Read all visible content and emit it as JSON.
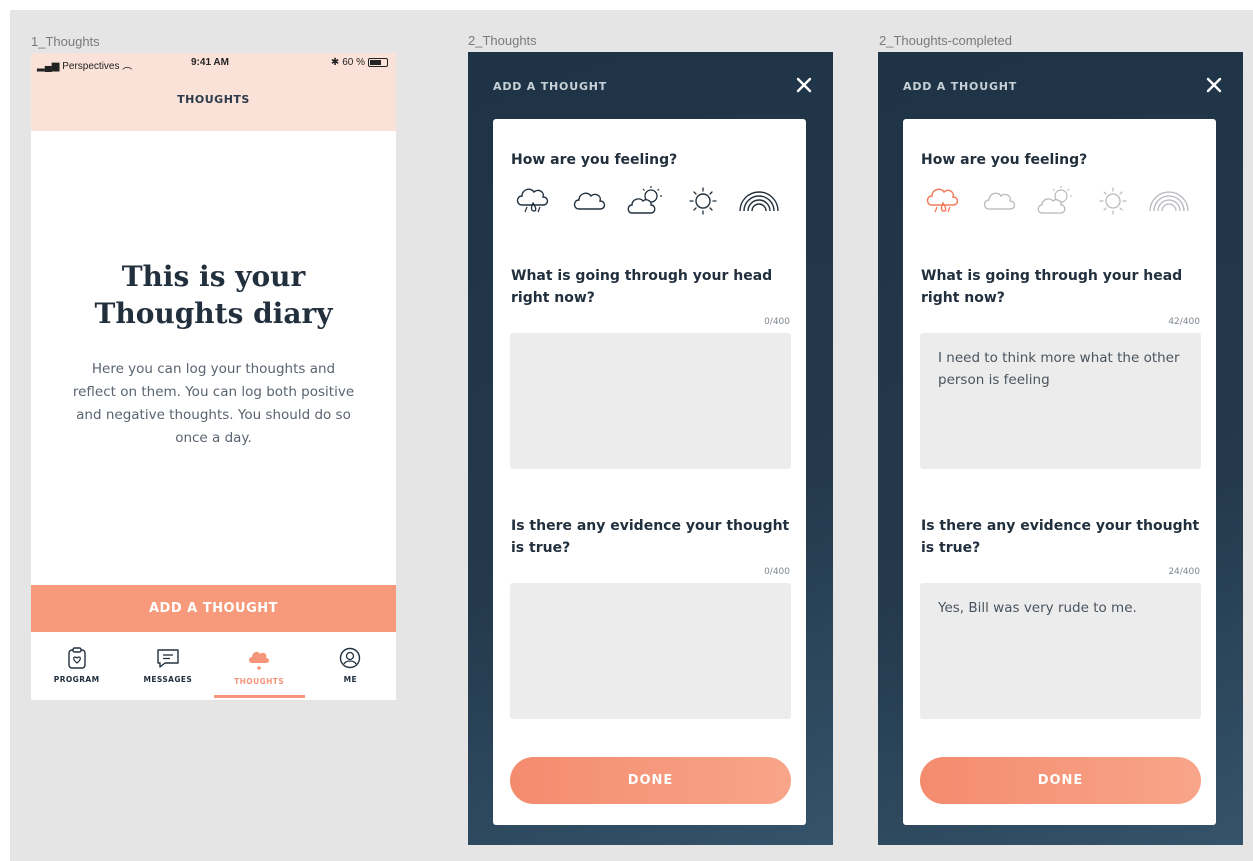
{
  "screens": {
    "s1": {
      "label": "1_Thoughts",
      "status": {
        "carrier": "Perspectives",
        "time": "9:41 AM",
        "battery": "60 %"
      },
      "title": "THOUGHTS",
      "heading_line1": "This is your",
      "heading_line2": "Thoughts diary",
      "body": "Here you can log your thoughts and reflect on them. You can log both positive and negative thoughts. You should do so once a day.",
      "add_button": "ADD A THOUGHT",
      "tabs": [
        {
          "label": "PROGRAM",
          "icon": "clipboard-icon"
        },
        {
          "label": "MESSAGES",
          "icon": "message-icon"
        },
        {
          "label": "THOUGHTS",
          "icon": "cloud-icon"
        },
        {
          "label": "ME",
          "icon": "user-icon"
        }
      ],
      "accent": "#f5957a"
    },
    "s2": {
      "label": "2_Thoughts",
      "modal_title": "ADD A THOUGHT",
      "q1": "How are you feeling?",
      "q2": "What is going through your head right now?",
      "q2_counter": "0/400",
      "q2_value": "",
      "q3": "Is there any evidence your thought is true?",
      "q3_counter": "0/400",
      "q3_value": "",
      "done": "DONE"
    },
    "s3": {
      "label": "2_Thoughts-completed",
      "modal_title": "ADD A THOUGHT",
      "q1": "How are you feeling?",
      "q2": "What is going through your head right now?",
      "q2_counter": "42/400",
      "q2_value": "I need to think more what the other person is feeling",
      "q3": "Is there any evidence your thought is true?",
      "q3_counter": "24/400",
      "q3_value": "Yes, Bill was very rude to me.",
      "done": "DONE",
      "selected_mood": "storm-icon"
    }
  },
  "moods": [
    "storm-icon",
    "cloud-icon",
    "partly-sunny-icon",
    "sun-icon",
    "rainbow-icon"
  ]
}
